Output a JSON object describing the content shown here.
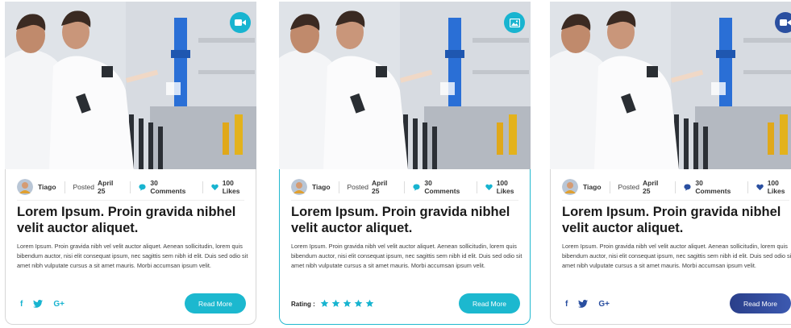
{
  "colors": {
    "accent": "#18b4d0",
    "navy": "#2a4fa0",
    "title": "#1b1b1b"
  },
  "cards": [
    {
      "media_icon": "video-camera-icon",
      "author": "Tiago",
      "posted_label": "Posted",
      "posted_date": "April 25",
      "comments": "30 Comments",
      "likes": "100 Likes",
      "title": "Lorem Ipsum. Proin gravida nibhel velit auctor aliquet.",
      "description": "Lorem Ipsum. Proin gravida nibh vel velit auctor aliquet. Aenean sollicitudin, lorem quis bibendum auctor, nisi elit consequat ipsum, nec sagittis sem nibh id elit. Duis sed odio sit amet nibh vulputate cursus a sit amet mauris. Morbi accumsan ipsum velit.",
      "socials": [
        "f",
        "G+"
      ],
      "cta": "Read More"
    },
    {
      "media_icon": "image-icon",
      "author": "Tiago",
      "posted_label": "Posted",
      "posted_date": "April 25",
      "comments": "30 Comments",
      "likes": "100 Likes",
      "title": "Lorem Ipsum. Proin gravida nibhel velit auctor aliquet.",
      "description": "Lorem Ipsum. Proin gravida nibh vel velit auctor aliquet. Aenean sollicitudin, lorem quis bibendum auctor, nisi elit consequat ipsum, nec sagittis sem nibh id elit. Duis sed odio sit amet nibh vulputate cursus a sit amet mauris. Morbi accumsan ipsum velit.",
      "rating_label": "Rating :",
      "rating_stars": 5,
      "cta": "Read More"
    },
    {
      "media_icon": "video-camera-icon",
      "author": "Tiago",
      "posted_label": "Posted",
      "posted_date": "April 25",
      "comments": "30 Comments",
      "likes": "100 Likes",
      "title": "Lorem Ipsum. Proin gravida nibhel velit auctor aliquet.",
      "description": "Lorem Ipsum. Proin gravida nibh vel velit auctor aliquet. Aenean sollicitudin, lorem quis bibendum auctor, nisi elit consequat ipsum, nec sagittis sem nibh id elit. Duis sed odio sit amet nibh vulputate cursus a sit amet mauris. Morbi accumsan ipsum velit.",
      "socials": [
        "f",
        "G+"
      ],
      "cta": "Read More"
    }
  ]
}
